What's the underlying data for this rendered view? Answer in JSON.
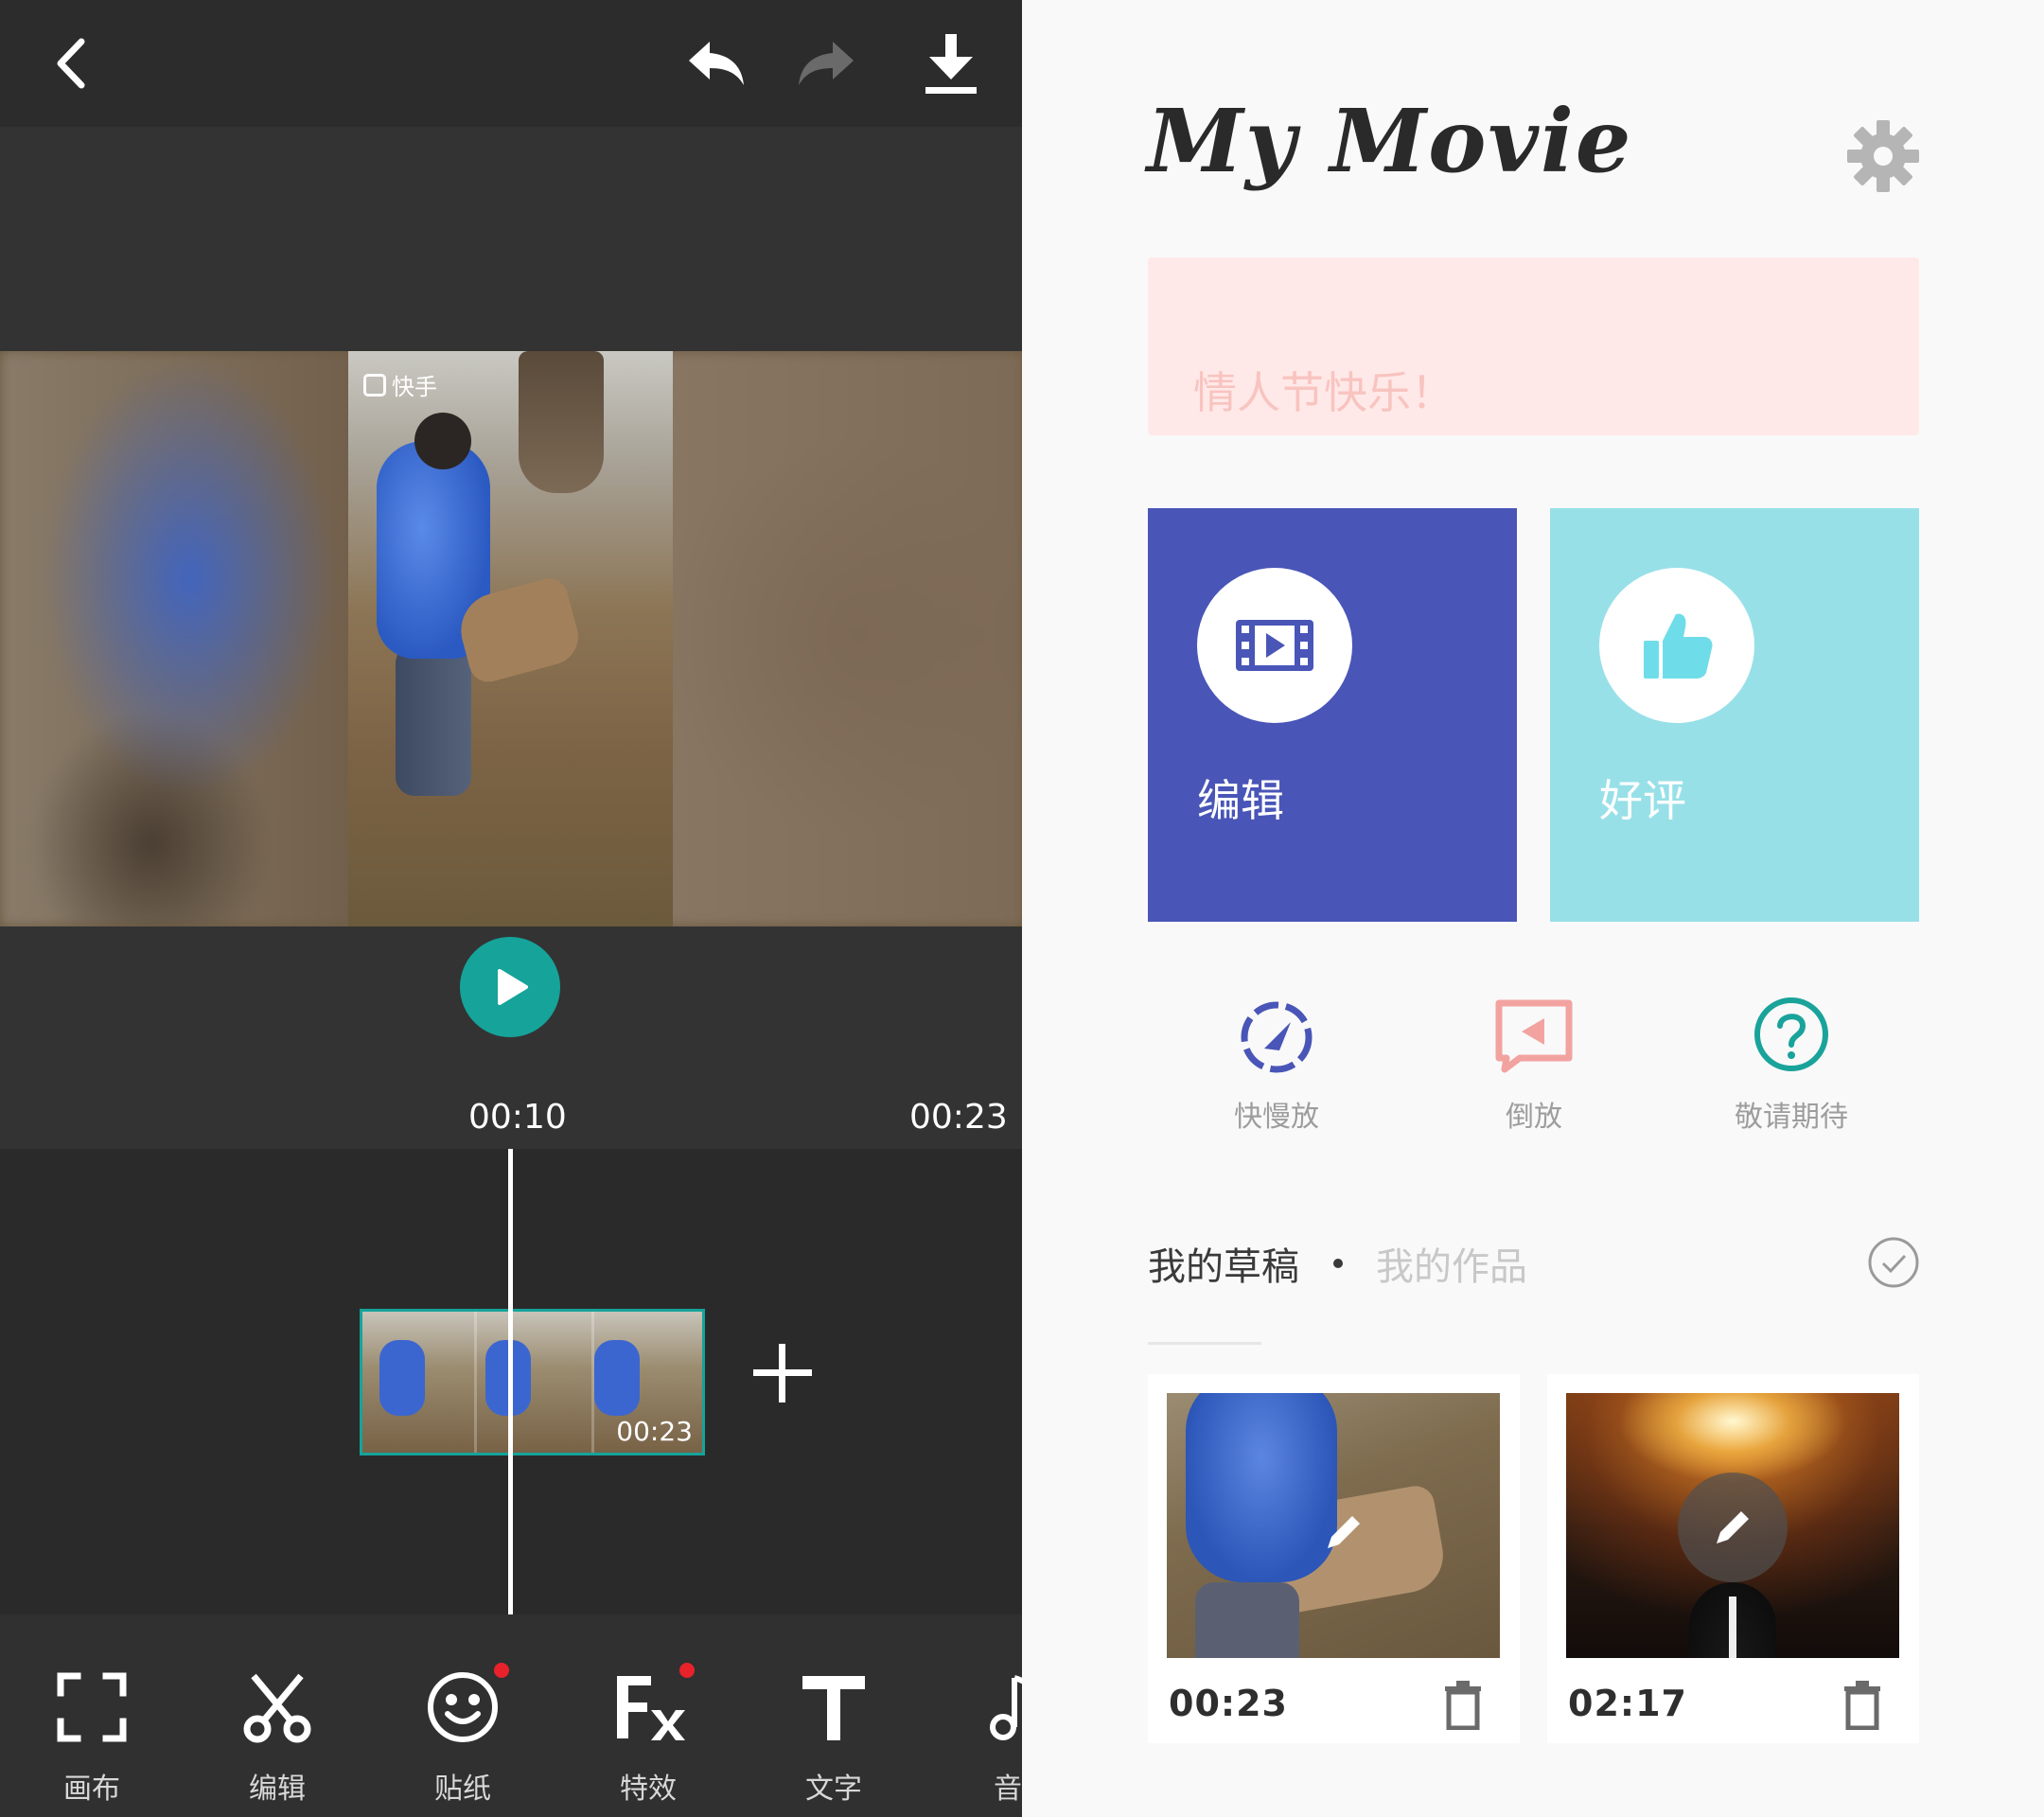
{
  "editor": {
    "top_icons": [
      "back-arrow-icon",
      "undo-icon",
      "redo-icon",
      "download-icon"
    ],
    "preview": {
      "watermark": "快手"
    },
    "current_time": "00:10",
    "total_time": "00:23",
    "clip": {
      "duration": "00:23"
    },
    "tools": [
      {
        "label": "画布",
        "icon": "canvas-frame-icon",
        "badge": false
      },
      {
        "label": "编辑",
        "icon": "scissors-icon",
        "badge": false
      },
      {
        "label": "贴纸",
        "icon": "smiley-icon",
        "badge": true
      },
      {
        "label": "特效",
        "icon": "fx-icon",
        "badge": true
      },
      {
        "label": "文字",
        "icon": "text-t-icon",
        "badge": false
      },
      {
        "label": "音",
        "icon": "music-note-icon",
        "badge": false
      }
    ],
    "colors": {
      "accent": "#15a39a",
      "badge": "#e8222a"
    }
  },
  "home": {
    "title": "My Movie",
    "banner_text": "情人节快乐！",
    "cards": [
      {
        "label": "编辑",
        "icon": "film-play-icon",
        "color": "#4955b7"
      },
      {
        "label": "好评",
        "icon": "thumbs-up-icon",
        "color": "#98e0e8"
      }
    ],
    "features": [
      {
        "label": "快慢放",
        "icon": "speed-dial-icon",
        "color": "#4955b7"
      },
      {
        "label": "倒放",
        "icon": "reverse-play-icon",
        "color": "#f2a3a0"
      },
      {
        "label": "敬请期待",
        "icon": "question-icon",
        "color": "#1aa39a"
      }
    ],
    "tabs": {
      "drafts": "我的草稿",
      "works": "我的作品"
    },
    "drafts": [
      {
        "duration": "00:23"
      },
      {
        "duration": "02:17"
      }
    ]
  }
}
